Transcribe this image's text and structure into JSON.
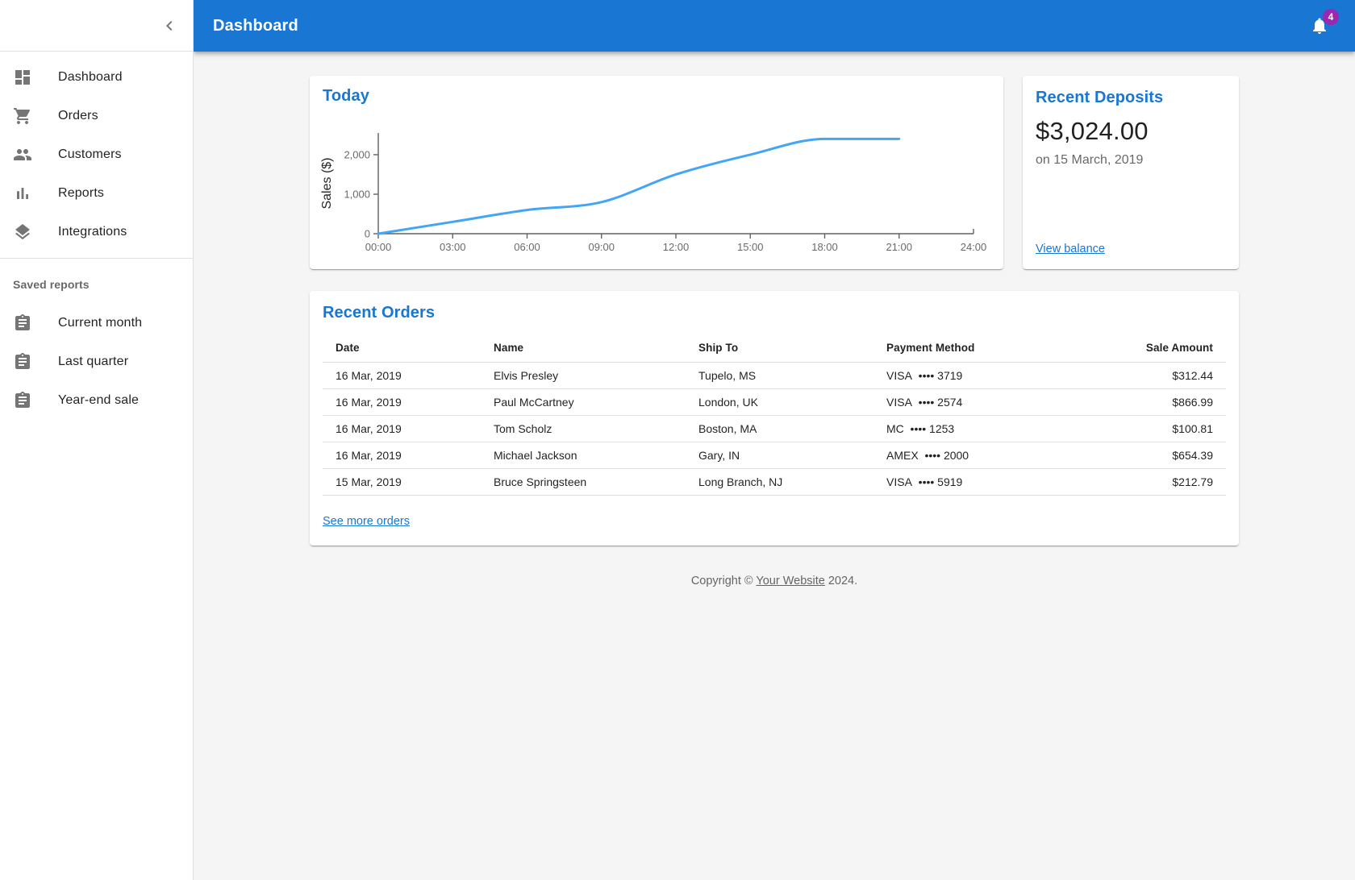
{
  "colors": {
    "primary": "#1976d2",
    "line": "#42a5f5",
    "badge": "#9c27b0",
    "axis": "#616161",
    "tick_label": "rgba(0,0,0,0.6)"
  },
  "appbar": {
    "title": "Dashboard",
    "bell_icon": "bell-icon",
    "notifications_count": "4"
  },
  "sidebar": {
    "collapse_icon": "chevron-left-icon",
    "main_items": [
      {
        "label": "Dashboard",
        "icon": "dashboard-icon"
      },
      {
        "label": "Orders",
        "icon": "shopping-cart-icon"
      },
      {
        "label": "Customers",
        "icon": "people-icon"
      },
      {
        "label": "Reports",
        "icon": "bar-chart-icon"
      },
      {
        "label": "Integrations",
        "icon": "layers-icon"
      }
    ],
    "section_title": "Saved reports",
    "secondary_items": [
      {
        "label": "Current month",
        "icon": "assignment-icon"
      },
      {
        "label": "Last quarter",
        "icon": "assignment-icon"
      },
      {
        "label": "Year-end sale",
        "icon": "assignment-icon"
      }
    ]
  },
  "chart_data": {
    "type": "line",
    "title": "Today",
    "x": [
      "00:00",
      "03:00",
      "06:00",
      "09:00",
      "12:00",
      "15:00",
      "18:00",
      "21:00",
      "24:00"
    ],
    "series": [
      {
        "name": "Sales",
        "values": [
          0,
          300,
          600,
          800,
          1500,
          2000,
          2400,
          2400,
          null
        ]
      }
    ],
    "xlabel": "",
    "ylabel": "Sales ($)",
    "ylim": [
      0,
      2550
    ],
    "yticks": [
      0,
      1000,
      2000
    ],
    "grid": false,
    "legend": "none"
  },
  "deposits": {
    "title": "Recent Deposits",
    "amount": "$3,024.00",
    "date": "on 15 March, 2019",
    "link_label": "View balance"
  },
  "orders": {
    "title": "Recent Orders",
    "headers": [
      "Date",
      "Name",
      "Ship To",
      "Payment Method",
      "Sale Amount"
    ],
    "rows": [
      {
        "date": "16 Mar, 2019",
        "name": "Elvis Presley",
        "ship_to": "Tupelo, MS",
        "payment": "VISA  •••• 3719",
        "amount": "$312.44"
      },
      {
        "date": "16 Mar, 2019",
        "name": "Paul McCartney",
        "ship_to": "London, UK",
        "payment": "VISA  •••• 2574",
        "amount": "$866.99"
      },
      {
        "date": "16 Mar, 2019",
        "name": "Tom Scholz",
        "ship_to": "Boston, MA",
        "payment": "MC  •••• 1253",
        "amount": "$100.81"
      },
      {
        "date": "16 Mar, 2019",
        "name": "Michael Jackson",
        "ship_to": "Gary, IN",
        "payment": "AMEX  •••• 2000",
        "amount": "$654.39"
      },
      {
        "date": "15 Mar, 2019",
        "name": "Bruce Springsteen",
        "ship_to": "Long Branch, NJ",
        "payment": "VISA  •••• 5919",
        "amount": "$212.79"
      }
    ],
    "link_label": "See more orders"
  },
  "footer": {
    "prefix": "Copyright © ",
    "link": "Your Website",
    "suffix": " 2024."
  }
}
